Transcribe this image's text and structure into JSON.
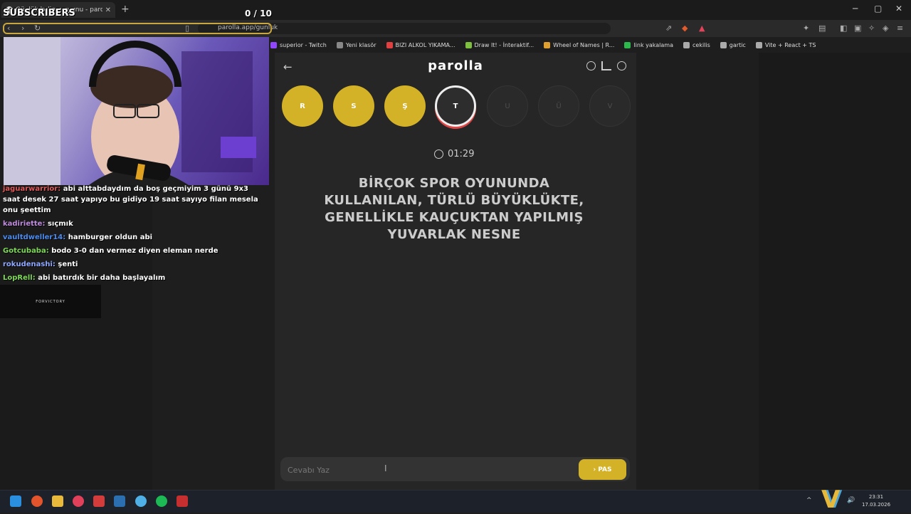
{
  "browser": {
    "tab_title": "Günlük kelime oyunu - parolla",
    "tab_close": "✕",
    "new_tab": "+",
    "url": "parolla.app/gunluk",
    "window_controls": [
      "─",
      "▢",
      "✕"
    ],
    "bookmarks": [
      {
        "label": "superior - Twitch",
        "color": "#9146ff"
      },
      {
        "label": "Yeni klasör",
        "color": "#888888"
      },
      {
        "label": "BIZI ALKOL YIKAMA...",
        "color": "#e04040"
      },
      {
        "label": "Draw It! - İnteraktif...",
        "color": "#7fbf3f"
      },
      {
        "label": "Wheel of Names | R...",
        "color": "#e0a030"
      },
      {
        "label": "link yakalama",
        "color": "#2db84d"
      },
      {
        "label": "cekilis",
        "color": "#aaaaaa"
      },
      {
        "label": "gartic",
        "color": "#aaaaaa"
      },
      {
        "label": "Vite + React + TS",
        "color": "#aaaaaa"
      }
    ]
  },
  "overlay": {
    "subscribers_label": "SUBSCRIBERS",
    "counter": "0  / 10",
    "sponsor": "FORVICTORY"
  },
  "chat": [
    {
      "user": "jaguarwarrior:",
      "color": "#e05a5a",
      "text": " abi alttabdaydım da boş geçmiyim 3 günü 9x3 saat desek 27 saat yapıyo bu gidiyo 19 saat sayıyo filan mesela onu şeettim"
    },
    {
      "user": "kadiriette:",
      "color": "#c18be0",
      "text": " sıçmık"
    },
    {
      "user": "vaultdweller14:",
      "color": "#4a8cf0",
      "text": " hamburger oldun abi"
    },
    {
      "user": "Gotcubaba:",
      "color": "#7ed957",
      "text": " bodo 3-0 dan vermez diyen eleman nerde"
    },
    {
      "user": "rokudenashi:",
      "color": "#8fa8ff",
      "text": " şenti"
    },
    {
      "user": "LopRell:",
      "color": "#7ed957",
      "text": " abi batırdık bir daha başlayalım"
    }
  ],
  "game": {
    "title": "parolla",
    "letters": [
      {
        "char": "R",
        "state": "done"
      },
      {
        "char": "S",
        "state": "done"
      },
      {
        "char": "Ş",
        "state": "done"
      },
      {
        "char": "T",
        "state": "active"
      },
      {
        "char": "U",
        "state": "pending"
      },
      {
        "char": "Ü",
        "state": "pending"
      },
      {
        "char": "V",
        "state": "pending"
      }
    ],
    "timer": "01:29",
    "question": "BİRÇOK SPOR OYUNUNDA KULLANILAN, TÜRLÜ BÜYÜKLÜKTE, GENELLİKLE KAUÇUKTAN YAPILMIŞ YUVARLAK NESNE",
    "answer_placeholder": "Cevabı Yaz",
    "pas_label": "PAS",
    "colors": {
      "done": "#d4b227",
      "active_ring": "#eeeeee",
      "bg": "#262626"
    }
  },
  "taskbar": {
    "time": "23:31",
    "date": "17.03.2026"
  }
}
